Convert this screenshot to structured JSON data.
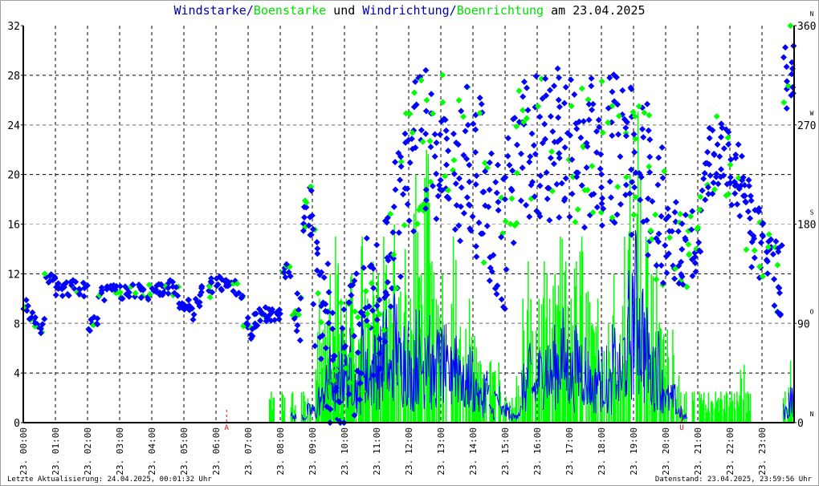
{
  "title": {
    "part1": "Windstarke",
    "sep1": "/",
    "part2": "Boenstarke",
    "part3": " und ",
    "part4": "Windrichtung",
    "sep2": "/",
    "part5": "Boenrichtung",
    "part6": " am 23.04.2025"
  },
  "footer": {
    "left": "Letzte Aktualisierung: 24.04.2025, 00:01:32 Uhr",
    "right": "Datenstand: 23.04.2025, 23:59:56 Uhr"
  },
  "colors": {
    "wind": "#0000ff",
    "gust": "#00ff00",
    "marker": "#ff0000",
    "grid": "#000000"
  },
  "chart_data": {
    "type": "line",
    "title": "Windstarke/Boenstarke und Windrichtung/Boenrichtung am 23.04.2025",
    "x_labels": [
      "23. 00:00",
      "23. 01:00",
      "23. 02:00",
      "23. 03:00",
      "23. 04:00",
      "23. 05:00",
      "23. 06:00",
      "23. 07:00",
      "23. 08:00",
      "23. 09:00",
      "23. 10:00",
      "23. 11:00",
      "23. 12:00",
      "23. 13:00",
      "23. 14:00",
      "23. 15:00",
      "23. 16:00",
      "23. 17:00",
      "23. 18:00",
      "23. 19:00",
      "23. 20:00",
      "23. 21:00",
      "23. 22:00",
      "23. 23:00"
    ],
    "y_left": {
      "ticks": [
        0,
        4,
        8,
        12,
        16,
        20,
        24,
        28,
        32
      ],
      "ylim": [
        0,
        32
      ]
    },
    "y_right": {
      "ticks": [
        0,
        90,
        180,
        270,
        360
      ],
      "ylim": [
        0,
        360
      ],
      "compass": [
        "N",
        "O",
        "S",
        "W",
        "N"
      ]
    },
    "markers": [
      {
        "label": "A",
        "hour": 6.33
      },
      {
        "label": "U",
        "hour": 20.5
      }
    ],
    "interval_minutes": 10,
    "series": [
      {
        "name": "Windstarke",
        "values": [
          0,
          0,
          0,
          0,
          0,
          0,
          0,
          0,
          0,
          0,
          0,
          0,
          0,
          0,
          0,
          0,
          0,
          0,
          0,
          0,
          0,
          0,
          0,
          0,
          0,
          0,
          0,
          0,
          0,
          0,
          0,
          0,
          0,
          0,
          0,
          0,
          0,
          0,
          0,
          0,
          0,
          0,
          0,
          0,
          0,
          0,
          0,
          0,
          0,
          0,
          0.5,
          0,
          0.5,
          1,
          1,
          2,
          3,
          4,
          3,
          5,
          4,
          5,
          3,
          6,
          4,
          5,
          5,
          6,
          4,
          7,
          5,
          6,
          4,
          6,
          5,
          8,
          4,
          5,
          5,
          4,
          6,
          5,
          3,
          4,
          3,
          2,
          3,
          1,
          2,
          1,
          1,
          0.5,
          1,
          3,
          4,
          3,
          4,
          5,
          4,
          5,
          6,
          5,
          4,
          5,
          5,
          4,
          3,
          4,
          4,
          3,
          5,
          4,
          6,
          8,
          10,
          8,
          6,
          4,
          5,
          3,
          2,
          2,
          1,
          0.5,
          0,
          0,
          0,
          0,
          0,
          0,
          0,
          0,
          0,
          0,
          0,
          0,
          0,
          0,
          0,
          0,
          0,
          0,
          1,
          2
        ]
      },
      {
        "name": "Boenstarke",
        "values": [
          0,
          0,
          0,
          0,
          0,
          0,
          0,
          0,
          0,
          0,
          0,
          0,
          0,
          0,
          0,
          0,
          0,
          0,
          0,
          0,
          0,
          0,
          0,
          0,
          0,
          0,
          0,
          0,
          0,
          0,
          0,
          0,
          0,
          0,
          0,
          0,
          0,
          0,
          0,
          0,
          0,
          0,
          0,
          0,
          0,
          0,
          2.5,
          0,
          2.5,
          0,
          2.5,
          0,
          2.5,
          2.5,
          5,
          10,
          8,
          12,
          15,
          10,
          10,
          12,
          8,
          15,
          10,
          13,
          12,
          15,
          10,
          16,
          12,
          14,
          10,
          20,
          12,
          22,
          13,
          10,
          12,
          10,
          15,
          13,
          8,
          10,
          7,
          5,
          8,
          5,
          5,
          4,
          3,
          2,
          4,
          10,
          13,
          8,
          10,
          13,
          10,
          12,
          15,
          13,
          10,
          13,
          15,
          13,
          8,
          10,
          10,
          8,
          12,
          10,
          15,
          20,
          28,
          20,
          15,
          12,
          13,
          8,
          7.5,
          7.5,
          5,
          2.5,
          0,
          2.5,
          2.5,
          2.5,
          2.5,
          2.5,
          2.5,
          2.5,
          2.5,
          2.5,
          5,
          2.5,
          0,
          0,
          0,
          0,
          0,
          0,
          2.5,
          5
        ]
      },
      {
        "name": "Windrichtung",
        "unit": "deg",
        "values": [
          105,
          100,
          90,
          88,
          130,
          130,
          122,
          120,
          122,
          124,
          118,
          120,
          88,
          95,
          120,
          118,
          120,
          120,
          118,
          120,
          120,
          120,
          118,
          118,
          120,
          122,
          122,
          124,
          120,
          110,
          105,
          100,
          110,
          118,
          120,
          124,
          126,
          126,
          124,
          122,
          120,
          90,
          82,
          92,
          96,
          98,
          96,
          96,
          135,
          138,
          100,
          95,
          180,
          190,
          125,
          110,
          80,
          60,
          50,
          50,
          45,
          60,
          70,
          80,
          100,
          110,
          110,
          130,
          150,
          170,
          200,
          220,
          240,
          250,
          260,
          250,
          240,
          250,
          260,
          250,
          240,
          230,
          250,
          240,
          220,
          230,
          200,
          180,
          170,
          160,
          190,
          210,
          240,
          250,
          250,
          245,
          250,
          245,
          250,
          255,
          250,
          245,
          250,
          245,
          240,
          250,
          250,
          245,
          240,
          245,
          250,
          250,
          245,
          240,
          240,
          230,
          220,
          200,
          190,
          180,
          170,
          165,
          160,
          155,
          160,
          165,
          190,
          220,
          240,
          245,
          245,
          235,
          230,
          220,
          210,
          190,
          170,
          160,
          150,
          145,
          135,
          130,
          310,
          330
        ]
      }
    ]
  }
}
